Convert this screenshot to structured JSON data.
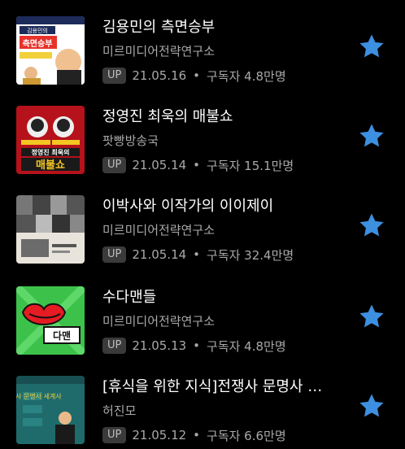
{
  "accent_color": "#3d8fe0",
  "items": [
    {
      "title": "김용민의 측면승부",
      "publisher": "미르미디어전략연구소",
      "badge": "UP",
      "date": "21.05.16",
      "subscribers": "구독자 4.8만명",
      "thumb_text": "측면승부",
      "thumb_subtext": "김용민의"
    },
    {
      "title": "정영진 최욱의 매불쇼",
      "publisher": "팟빵방송국",
      "badge": "UP",
      "date": "21.05.14",
      "subscribers": "구독자 15.1만명",
      "thumb_text": "매불쇼",
      "thumb_subtext": "정영진 최욱의"
    },
    {
      "title": "이박사와 이작가의 이이제이",
      "publisher": "미르미디어전략연구소",
      "badge": "UP",
      "date": "21.05.14",
      "subscribers": "구독자 32.4만명",
      "thumb_text": "",
      "thumb_subtext": ""
    },
    {
      "title": "수다맨들",
      "publisher": "미르미디어전략연구소",
      "badge": "UP",
      "date": "21.05.13",
      "subscribers": "구독자 4.8만명",
      "thumb_text": "다맨",
      "thumb_subtext": ""
    },
    {
      "title": "[휴식을 위한 지식]전쟁사 문명사 …",
      "publisher": "허진모",
      "badge": "UP",
      "date": "21.05.12",
      "subscribers": "구독자 6.6만명",
      "thumb_text": "전쟁사 문명사 세계사",
      "thumb_subtext": ""
    }
  ]
}
